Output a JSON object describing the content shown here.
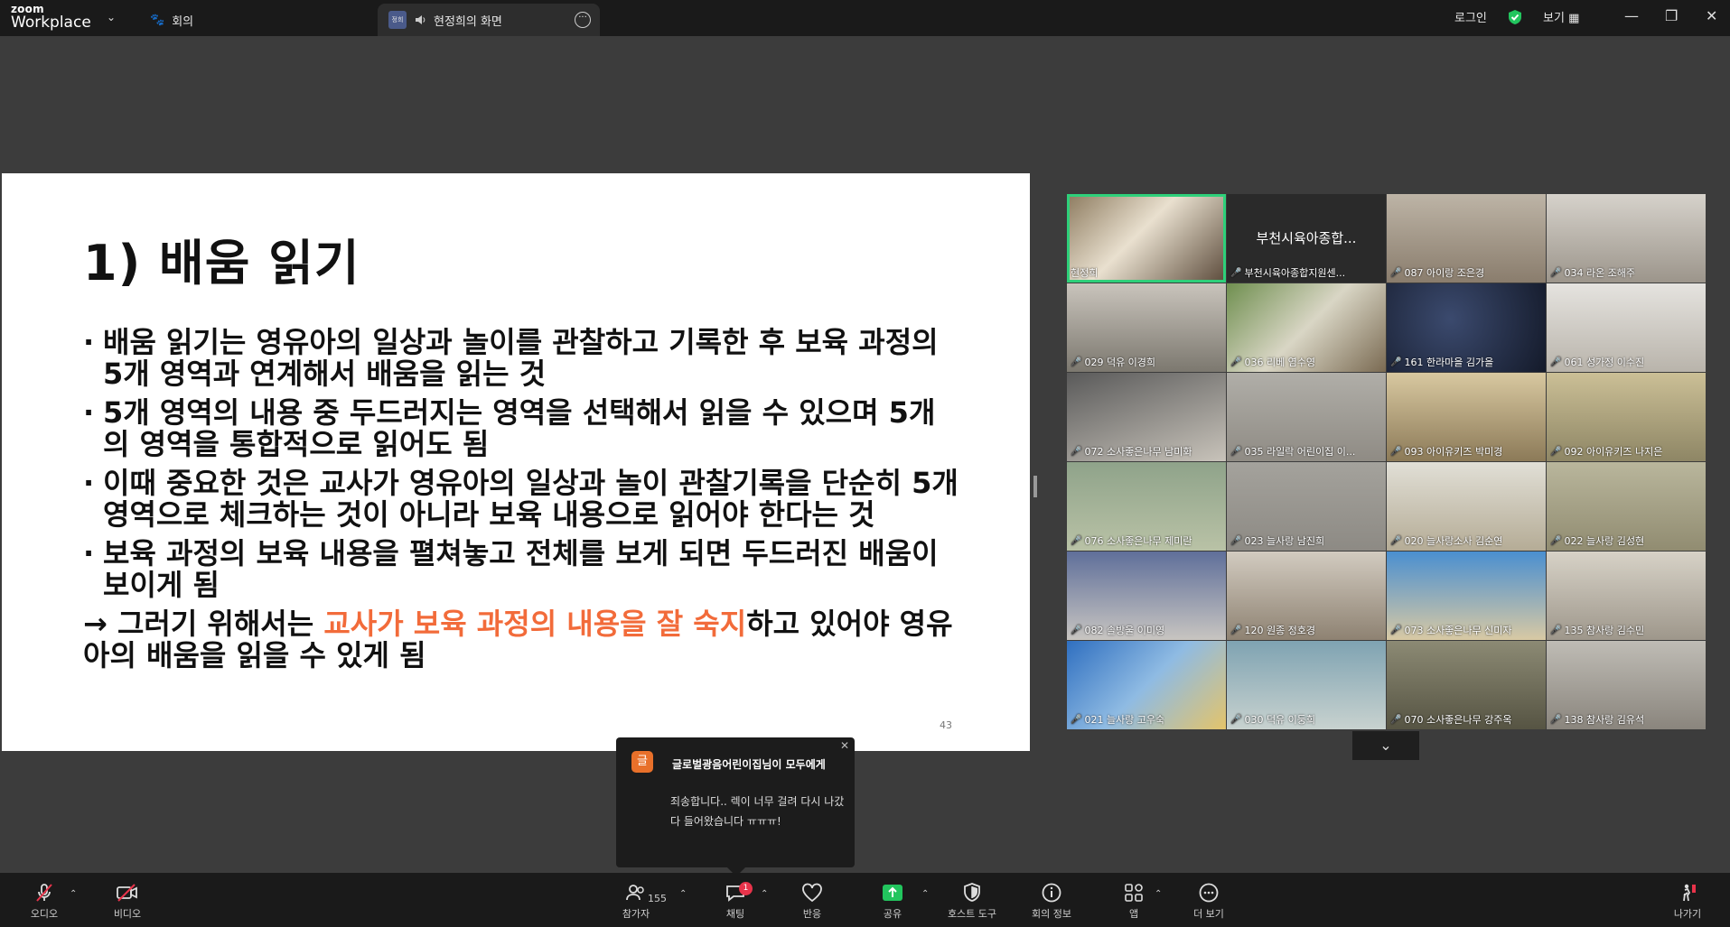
{
  "titlebar": {
    "brand_top": "zoom",
    "brand_bottom": "Workplace",
    "meeting_tab": "회의",
    "share_tab_avatar": "정희",
    "share_tab": "현정희의 화면",
    "login": "로그인",
    "view": "보기"
  },
  "slide": {
    "title": "1) 배움 읽기",
    "bullets": [
      "배움 읽기는 영유아의 일상과 놀이를 관찰하고 기록한 후 보육 과정의 5개 영역과 연계해서 배움을 읽는 것",
      "5개 영역의 내용 중 두드러지는 영역을 선택해서 읽을 수 있으며 5개의 영역을 통합적으로 읽어도 됨",
      "이때 중요한 것은 교사가 영유아의 일상과 놀이 관찰기록을 단순히 5개 영역으로 체크하는 것이 아니라 보육 내용으로 읽어야 한다는 것",
      "보육 과정의 보육 내용을 펼쳐놓고 전체를 보게 되면 두드러진 배움이 보이게 됨"
    ],
    "arrow_pre": "→ 그러기 위해서는 ",
    "arrow_highlight": "교사가 보육 과정의 내용을 잘 숙지",
    "arrow_post": "하고 있어야 영유아의 배움을 읽을 수 있게 됨",
    "page_number": "43",
    "highlight_color": "#f26b3a"
  },
  "gallery": {
    "tiles": [
      {
        "name": "현정희",
        "muted": false
      },
      {
        "name": "부천시육아종합지원센...",
        "center": "부천시육아종합...",
        "muted": true
      },
      {
        "name": "087 아이랑 조은경",
        "muted": true
      },
      {
        "name": "034 라온 조해주",
        "muted": true
      },
      {
        "name": "029 덕유 이경희",
        "muted": true
      },
      {
        "name": "036 리베 염수영",
        "muted": true
      },
      {
        "name": "161 한라마을 김가을",
        "muted": true
      },
      {
        "name": "061 성가정 이수진",
        "muted": true
      },
      {
        "name": "072 소사좋은나무 남미화",
        "muted": true
      },
      {
        "name": "035 라일락 어린이집 이...",
        "muted": true
      },
      {
        "name": "093 아이유키즈 박미경",
        "muted": true
      },
      {
        "name": "092 아이유키즈 나지은",
        "muted": true
      },
      {
        "name": "076 소사좋은나무 제미란",
        "muted": true
      },
      {
        "name": "023 늘사랑 남진희",
        "muted": true
      },
      {
        "name": "020 늘사랑소사 김순연",
        "muted": true
      },
      {
        "name": "022 늘사랑 김성현",
        "muted": true
      },
      {
        "name": "082 솔방울 이미영",
        "muted": true
      },
      {
        "name": "120 원종 정호경",
        "muted": true
      },
      {
        "name": "073 소사좋은나무 신미자",
        "muted": true
      },
      {
        "name": "135 참사랑 김수민",
        "muted": true
      },
      {
        "name": "021 늘사랑 고우숙",
        "muted": true
      },
      {
        "name": "030 덕유 이둥희",
        "muted": true
      },
      {
        "name": "070 소사좋은나무 강주옥",
        "muted": true
      },
      {
        "name": "138 참사랑 김유석",
        "muted": true
      }
    ]
  },
  "chat_popup": {
    "avatar": "글",
    "from": "글로벌광음어린이집님이 모두에게",
    "message": "죄송합니다.. 렉이 너무 걸려 다시 나갔다 들어왔습니다 ㅠㅠㅠ!"
  },
  "toolbar": {
    "audio": "오디오",
    "video": "비디오",
    "participants": "참가자",
    "participants_count": "155",
    "chat": "채팅",
    "chat_badge": "1",
    "reactions": "반응",
    "share": "공유",
    "host_tools": "호스트 도구",
    "meeting_info": "회의 정보",
    "apps": "앱",
    "more": "더 보기",
    "leave": "나가기"
  }
}
